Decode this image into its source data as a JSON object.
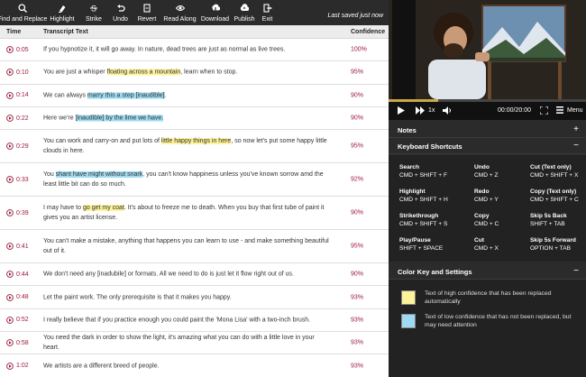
{
  "toolbar": {
    "buttons": [
      {
        "label": "Find and Replace",
        "icon": "search-icon"
      },
      {
        "label": "Highlight",
        "icon": "highlighter-icon"
      },
      {
        "label": "Strike",
        "icon": "strikethrough-icon"
      },
      {
        "label": "Undo",
        "icon": "undo-icon"
      },
      {
        "label": "Revert",
        "icon": "revert-icon"
      },
      {
        "label": "Read Along",
        "icon": "eye-icon"
      },
      {
        "label": "Download",
        "icon": "download-icon"
      },
      {
        "label": "Publish",
        "icon": "cloud-upload-icon"
      },
      {
        "label": "Exit",
        "icon": "exit-icon"
      }
    ],
    "status": "Last saved just now"
  },
  "columns": {
    "time": "Time",
    "text": "Transcript Text",
    "confidence": "Confidence"
  },
  "rows": [
    {
      "time": "0:05",
      "parts": [
        [
          "If you hypnotize it, it will go away. In nature, dead trees are just as normal as live trees.",
          ""
        ]
      ],
      "confidence": "100%"
    },
    {
      "time": "0:10",
      "parts": [
        [
          "You are just a whisper ",
          ""
        ],
        [
          "floating across a mountain",
          "y"
        ],
        [
          ", learn when to stop.",
          ""
        ]
      ],
      "confidence": "95%"
    },
    {
      "time": "0:14",
      "parts": [
        [
          "We can always ",
          ""
        ],
        [
          "marry this a step [inaudible]",
          "b"
        ],
        [
          ".",
          ""
        ]
      ],
      "confidence": "90%"
    },
    {
      "time": "0:22",
      "parts": [
        [
          "Here we're ",
          ""
        ],
        [
          "[inaudible] by the lime we have.",
          "b"
        ]
      ],
      "confidence": "90%"
    },
    {
      "time": "0:29",
      "parts": [
        [
          "You can work and carry-on and put lots of ",
          ""
        ],
        [
          "little happy things in here",
          "y"
        ],
        [
          ", so now let's put some happy little clouds in here.",
          ""
        ]
      ],
      "confidence": "95%"
    },
    {
      "time": "0:33",
      "parts": [
        [
          "You ",
          ""
        ],
        [
          "shant have might without snark",
          "b"
        ],
        [
          ", you can't know happiness unless you've known sorrow amd the least little bit can do so much.",
          ""
        ]
      ],
      "confidence": "92%"
    },
    {
      "time": "0:39",
      "parts": [
        [
          "I may have to ",
          ""
        ],
        [
          "go get my coat",
          "y"
        ],
        [
          ". It's about to freeze me to death. When you buy that first tube of paint it gives you an artist license.",
          ""
        ]
      ],
      "confidence": "90%"
    },
    {
      "time": "0:41",
      "parts": [
        [
          "You can't make a mistake, anything that happens you can learn to use - and make something beautiful out of it.",
          ""
        ]
      ],
      "confidence": "95%"
    },
    {
      "time": "0:44",
      "parts": [
        [
          "We don't need any [inadubile] or formats. All we need to do is just let it flow right out of us.",
          ""
        ]
      ],
      "confidence": "90%"
    },
    {
      "time": "0:48",
      "parts": [
        [
          "Let the paint work. The only prerequisite is that it makes you happy.",
          ""
        ]
      ],
      "confidence": "93%"
    },
    {
      "time": "0:52",
      "parts": [
        [
          "I really believe that if you practice enough you could paint the 'Mona Lisa' with a two-inch brush.",
          ""
        ]
      ],
      "confidence": "93%"
    },
    {
      "time": "0:58",
      "parts": [
        [
          "You need the dark in order to show the light, it's amazing what you can do with a little love in your heart.",
          ""
        ]
      ],
      "confidence": "93%"
    },
    {
      "time": "1:02",
      "parts": [
        [
          "We artists are a different breed of people.",
          ""
        ]
      ],
      "confidence": "93%"
    }
  ],
  "player": {
    "speed": "1x",
    "time": "00:00/20:00",
    "menu": "Menu",
    "progress": 0.25
  },
  "notes": {
    "title": "Notes",
    "sign": "+"
  },
  "shortcuts_section": {
    "title": "Keyboard Shortcuts",
    "sign": "−",
    "items": [
      {
        "name": "Search",
        "keys": "CMD + SHIFT + F"
      },
      {
        "name": "Undo",
        "keys": "CMD + Z"
      },
      {
        "name": "Cut (Text only)",
        "keys": "CMD + SHIFT + X"
      },
      {
        "name": "Highlight",
        "keys": "CMD + SHIFT + H"
      },
      {
        "name": "Redo",
        "keys": "CMD + Y"
      },
      {
        "name": "Copy (Text only)",
        "keys": "CMD + SHIFT + C"
      },
      {
        "name": "Strikethrough",
        "keys": "CMD + SHIFT + S"
      },
      {
        "name": "Copy",
        "keys": "CMD + C"
      },
      {
        "name": "Skip 5s Back",
        "keys": "SHIFT + TAB"
      },
      {
        "name": "Play/Pause",
        "keys": "SHIFT + SPACE"
      },
      {
        "name": "Cut",
        "keys": "CMD + X"
      },
      {
        "name": "Skip 5s Forward",
        "keys": "OPTION + TAB"
      }
    ]
  },
  "color_key": {
    "title": "Color Key and Settings",
    "sign": "−",
    "items": [
      {
        "color": "#fdf39a",
        "text": "Text of high confidence that has been replaced automatically"
      },
      {
        "color": "#9edbf2",
        "text": "Text of low confidence that has not been replaced, but may need attention"
      }
    ]
  },
  "colors": {
    "accent": "#9b1b3a",
    "toolbar_bg": "#2b2b2b",
    "highlight_high": "#fdf39a",
    "highlight_low": "#9edbf2"
  }
}
